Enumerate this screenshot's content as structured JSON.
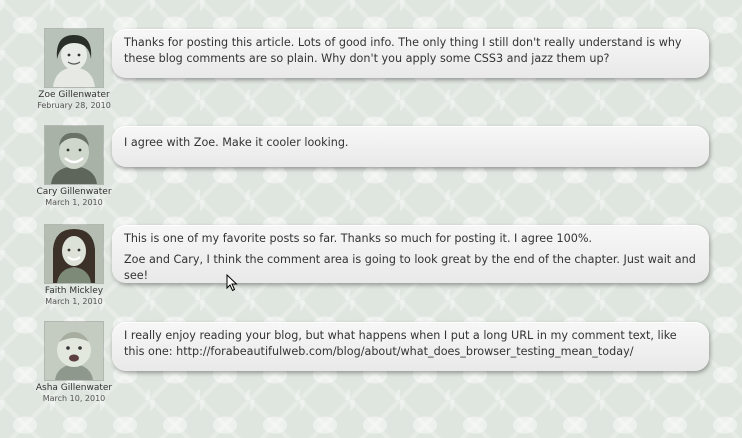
{
  "comments": [
    {
      "author": "Zoe Gillenwater",
      "date": "February 28, 2010",
      "avatar_icon": "woman-short-hair-avatar",
      "paragraphs": [
        "Thanks for posting this article. Lots of good info. The only thing I still don't really understand is why these blog comments are so plain. Why don't you apply some CSS3 and jazz them up?"
      ]
    },
    {
      "author": "Cary Gillenwater",
      "date": "March 1, 2010",
      "avatar_icon": "man-smiling-avatar",
      "paragraphs": [
        "I agree with Zoe. Make it cooler looking."
      ]
    },
    {
      "author": "Faith Mickley",
      "date": "March 1, 2010",
      "avatar_icon": "woman-long-hair-avatar",
      "paragraphs": [
        "This is one of my favorite posts so far. Thanks so much for posting it. I agree 100%.",
        "Zoe and Cary, I think the comment area is going to look great by the end of the chapter. Just wait and see!"
      ]
    },
    {
      "author": "Asha Gillenwater",
      "date": "March 10, 2010",
      "avatar_icon": "baby-avatar",
      "paragraphs": [
        "I really enjoy reading your blog, but what happens when I put a long URL in my comment text, like this one: http://forabeautifulweb.com/blog/about/what_does_browser_testing_mean_today/"
      ]
    }
  ],
  "colors": {
    "background": "#dfe5df",
    "bubble": "#f2f2f2",
    "text": "#333333"
  }
}
